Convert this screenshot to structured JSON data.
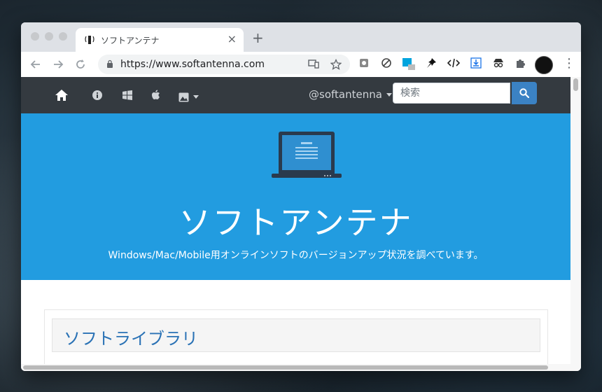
{
  "browser": {
    "tab_title": "ソフトアンテナ",
    "tab_close": "×",
    "new_tab": "+",
    "url": "https://www.softantenna.com",
    "menu_dots": "⋮"
  },
  "site": {
    "handle": "@softantenna",
    "search_placeholder": "検索",
    "hero_title": "ソフトアンテナ",
    "hero_subtitle": "Windows/Mac/Mobile用オンラインソフトのバージョンアップ状況を調べています。",
    "section_title": "ソフトライブラリ"
  },
  "colors": {
    "navbar": "#343a40",
    "hero": "#229ce0",
    "search_button": "#3b82c4",
    "section_title": "#2a72b5"
  },
  "icons": [
    "home-icon",
    "info-icon",
    "windows-icon",
    "apple-icon",
    "image-icon",
    "search-icon",
    "laptop-icon"
  ]
}
